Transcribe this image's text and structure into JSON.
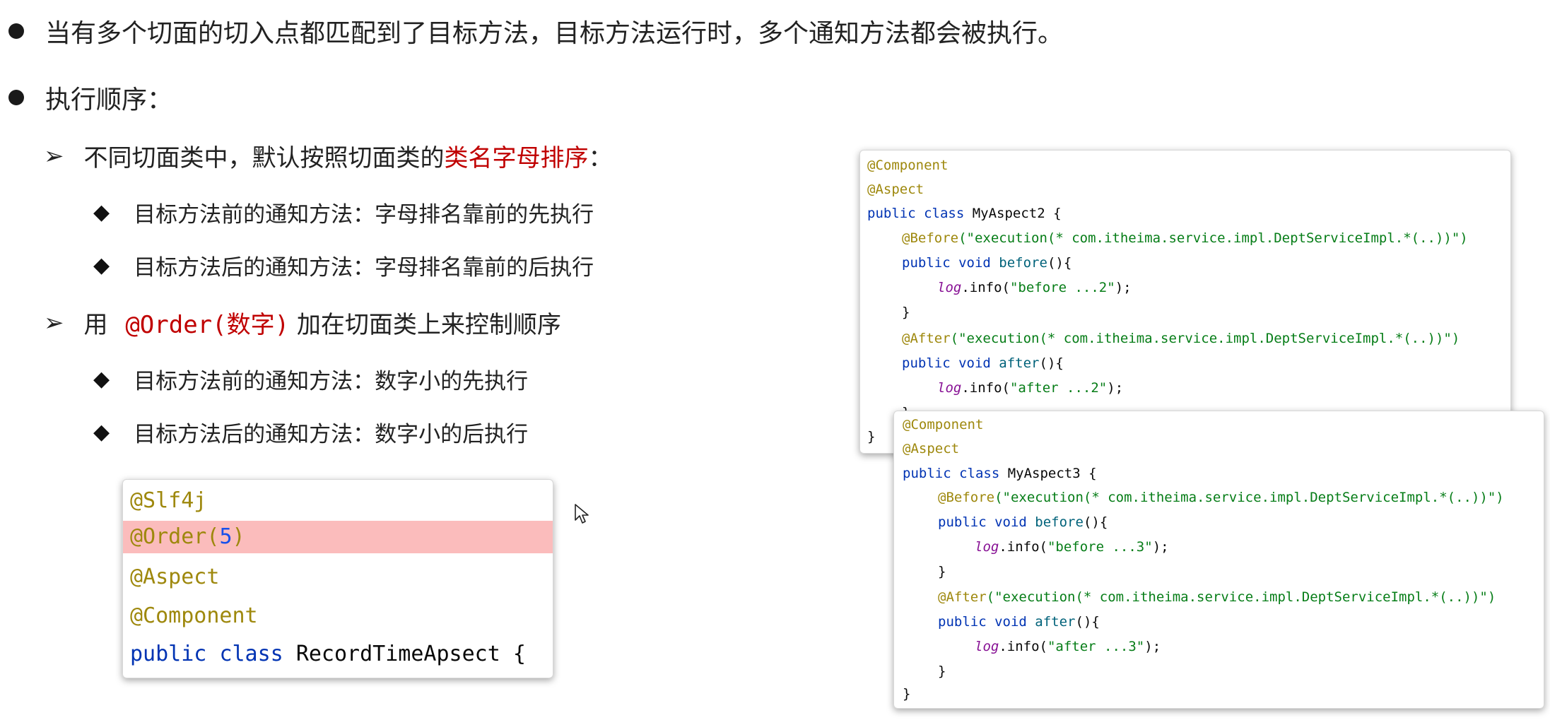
{
  "bullets": {
    "b1": "当有多个切面的切入点都匹配到了目标方法，目标方法运行时，多个通知方法都会被执行。",
    "b2": "执行顺序："
  },
  "sub1": {
    "prefix": "不同切面类中，默认按照切面类的",
    "highlight": "类名字母排序",
    "suffix": "：",
    "items": [
      "目标方法前的通知方法：字母排名靠前的先执行",
      "目标方法后的通知方法：字母排名靠前的后执行"
    ]
  },
  "sub2": {
    "prefix": "用 ",
    "highlight": "@Order(数字)",
    "suffix": " 加在切面类上来控制顺序",
    "items": [
      "目标方法前的通知方法：数字小的先执行",
      "目标方法后的通知方法：数字小的后执行"
    ]
  },
  "code_left": {
    "slf4j": "@Slf4j",
    "order_ann": "@Order(",
    "order_num": "5",
    "order_close": ")",
    "aspect": "@Aspect",
    "component": "@Component",
    "kw_public": "public",
    "kw_class": "class",
    "class_name": "RecordTimeApsect {"
  },
  "code_a2": {
    "component": "@Component",
    "aspect": "@Aspect",
    "kw_public_class": "public class",
    "class_name": "MyAspect2 {",
    "before_ann": "@Before",
    "before_expr": "(\"execution(* com.itheima.service.impl.DeptServiceImpl.*(..))\")",
    "before_sig_kw": "public void",
    "before_sig_name": "before",
    "before_sig_paren": "(){",
    "log1": "log",
    "log1_call": ".info(",
    "log1_str": "\"before ...2\"",
    "log1_end": ");",
    "close1": "}",
    "after_ann": "@After",
    "after_expr": "(\"execution(* com.itheima.service.impl.DeptServiceImpl.*(..))\")",
    "after_sig_kw": "public void",
    "after_sig_name": "after",
    "after_sig_paren": "(){",
    "log2": "log",
    "log2_call": ".info(",
    "log2_str": "\"after ...2\"",
    "log2_end": ");",
    "close2": "}",
    "close_class": "}"
  },
  "code_a3": {
    "component": "@Component",
    "aspect": "@Aspect",
    "kw_public_class": "public class",
    "class_name": "MyAspect3 {",
    "before_ann": "@Before",
    "before_expr": "(\"execution(* com.itheima.service.impl.DeptServiceImpl.*(..))\")",
    "before_sig_kw": "public void",
    "before_sig_name": "before",
    "before_sig_paren": "(){",
    "log1": "log",
    "log1_call": ".info(",
    "log1_str": "\"before ...3\"",
    "log1_end": ");",
    "close1": "}",
    "after_ann": "@After",
    "after_expr": "(\"execution(* com.itheima.service.impl.DeptServiceImpl.*(..))\")",
    "after_sig_kw": "public void",
    "after_sig_name": "after",
    "after_sig_paren": "(){",
    "log2": "log",
    "log2_call": ".info(",
    "log2_str": "\"after ...3\"",
    "log2_end": ");",
    "close2": "}",
    "close_class": "}"
  },
  "icons": {
    "bullet": "filled-circle-icon",
    "sub_bullet": "arrowhead-icon",
    "item_bullet": "diamond-icon",
    "cursor": "mouse-pointer-icon"
  },
  "colors": {
    "highlight_text": "#c00000",
    "highlight_row": "#fbbcbc",
    "annotation": "#9e880d",
    "keyword": "#0033b3",
    "string": "#067d17"
  }
}
